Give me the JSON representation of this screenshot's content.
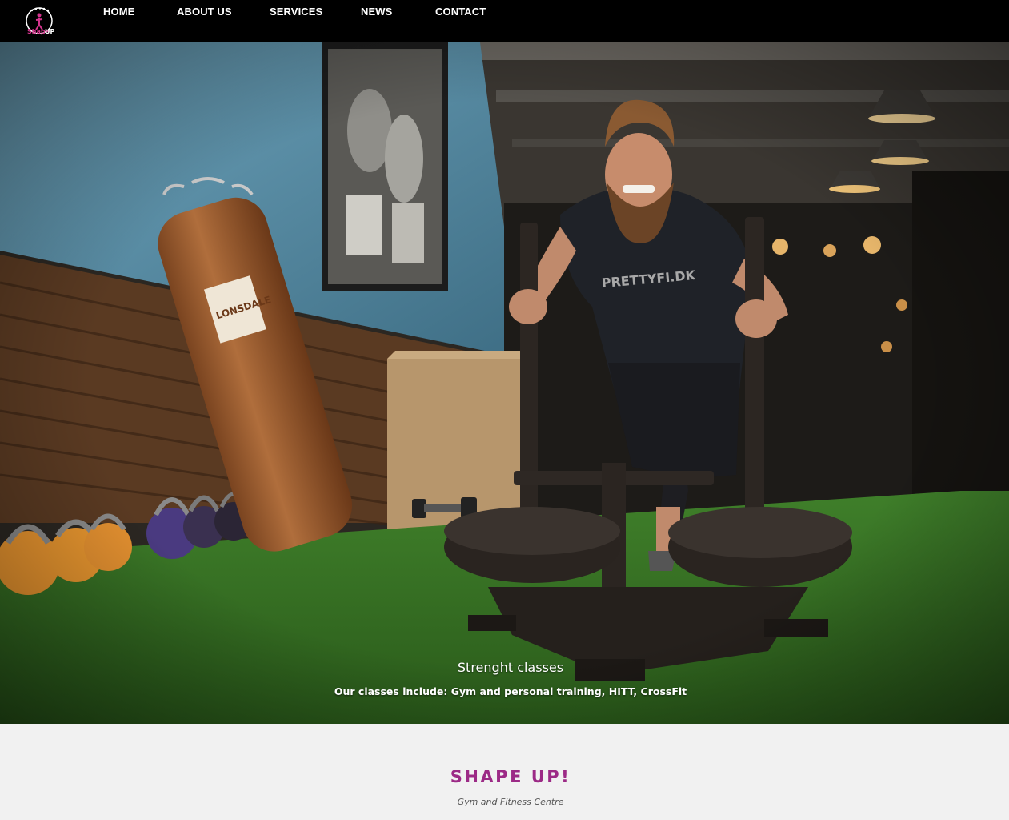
{
  "logo": {
    "icon": "shape-up-logo",
    "text": "Shape UP!"
  },
  "nav": {
    "items": [
      {
        "label": "HOME"
      },
      {
        "label": "ABOUT US"
      },
      {
        "label": "SERVICES"
      },
      {
        "label": "NEWS"
      },
      {
        "label": "CONTACT"
      }
    ]
  },
  "hero": {
    "image": "gym-man-pushing-weighted-sled",
    "title": "Strenght classes",
    "subtitle": "Our classes include: Gym and personal training, HITT, CrossFit"
  },
  "about": {
    "title": "SHAPE UP!",
    "tagline": "Gym and Fitness Centre"
  },
  "colors": {
    "nav_bg": "#000000",
    "accent": "#9c2a86",
    "section_bg": "#f1f1f1"
  }
}
